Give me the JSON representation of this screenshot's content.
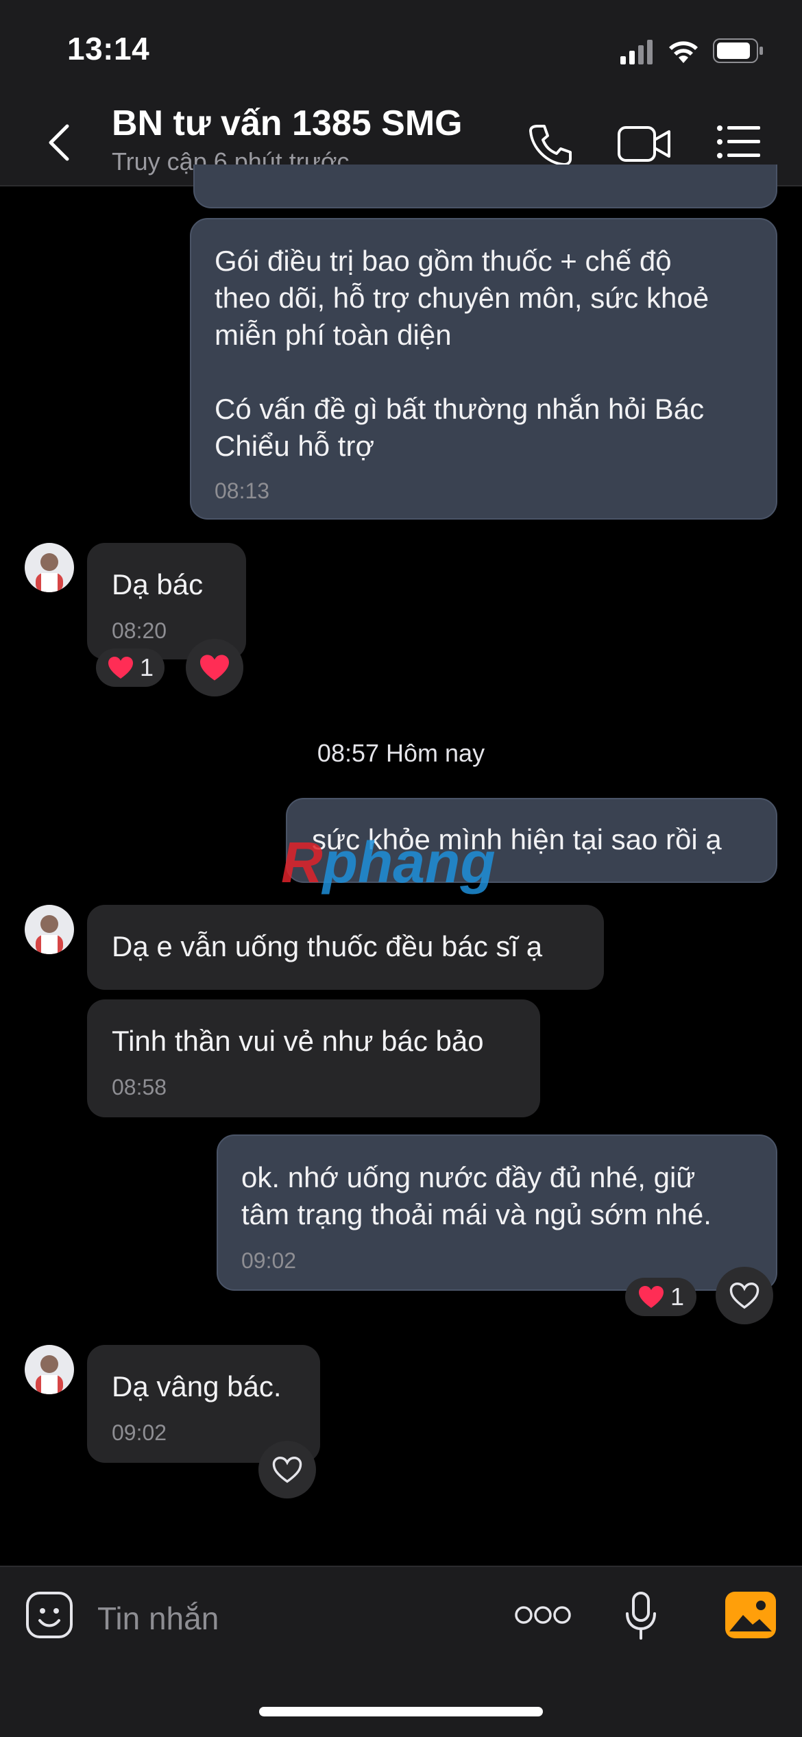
{
  "status_bar": {
    "time": "13:14"
  },
  "header": {
    "title": "BN tư vấn 1385 SMG",
    "subtitle": "Truy cập 6 phút trước"
  },
  "messages": [
    {
      "side": "sent",
      "text": "Gói điều trị bao gồm thuốc + chế độ\ntheo dõi, hỗ trợ chuyên môn, sức khoẻ\nmiễn phí toàn diện\n\nCó vấn đề gì bất thường nhắn hỏi Bác\nChiểu hỗ trợ",
      "time": "08:13"
    },
    {
      "side": "received",
      "text": "Dạ bác",
      "time": "08:20",
      "reaction_count": "1"
    },
    {
      "side": "sent",
      "text": "sức khỏe mình hiện tại sao rồi ạ"
    },
    {
      "side": "received",
      "text": "Dạ e vẫn uống thuốc đều bác sĩ ạ"
    },
    {
      "side": "received",
      "text": "Tinh thần vui vẻ như bác bảo",
      "time": "08:58"
    },
    {
      "side": "sent",
      "text": "ok. nhớ uống nước đầy đủ nhé, giữ\ntâm trạng thoải mái và ngủ sớm nhé.",
      "time": "09:02",
      "reaction_count": "1"
    },
    {
      "side": "received",
      "text": "Dạ vâng bác.",
      "time": "09:02"
    }
  ],
  "day_separator": "08:57 Hôm nay",
  "watermark": {
    "part1": "R",
    "part2": "phang"
  },
  "composer": {
    "placeholder": "Tin nhắn"
  },
  "colors": {
    "heart": "#ff2d55",
    "sent_bubble": "#3a4251",
    "received_bubble": "#262628",
    "accent_orange": "#ff9f0a"
  },
  "icons": [
    "back-chevron-icon",
    "phone-icon",
    "video-icon",
    "menu-list-icon",
    "sticker-icon",
    "more-dots-icon",
    "microphone-icon",
    "image-icon",
    "heart-icon",
    "signal-icon",
    "wifi-icon",
    "battery-icon"
  ]
}
